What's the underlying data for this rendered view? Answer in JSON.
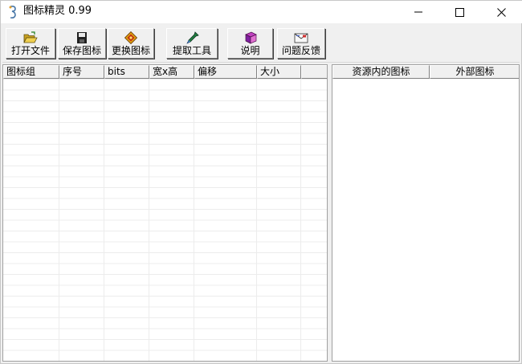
{
  "window": {
    "title": "图标精灵 0.99",
    "controls": {
      "minimize": "minimize-icon",
      "maximize": "maximize-icon",
      "close": "close-icon"
    }
  },
  "toolbar": {
    "open_label": "打开文件",
    "save_label": "保存图标",
    "replace_label": "更换图标",
    "extract_label": "提取工具",
    "help_label": "说明",
    "feedback_label": "问题反馈"
  },
  "left_table": {
    "columns": [
      "图标组",
      "序号",
      "bits",
      "宽x高",
      "偏移",
      "大小",
      ""
    ],
    "rows": []
  },
  "right_table": {
    "columns": [
      "资源内的图标",
      "外部图标"
    ]
  },
  "colors": {
    "background": "#f0f0f0",
    "pane": "#ffffff",
    "grid": "#ececec"
  }
}
